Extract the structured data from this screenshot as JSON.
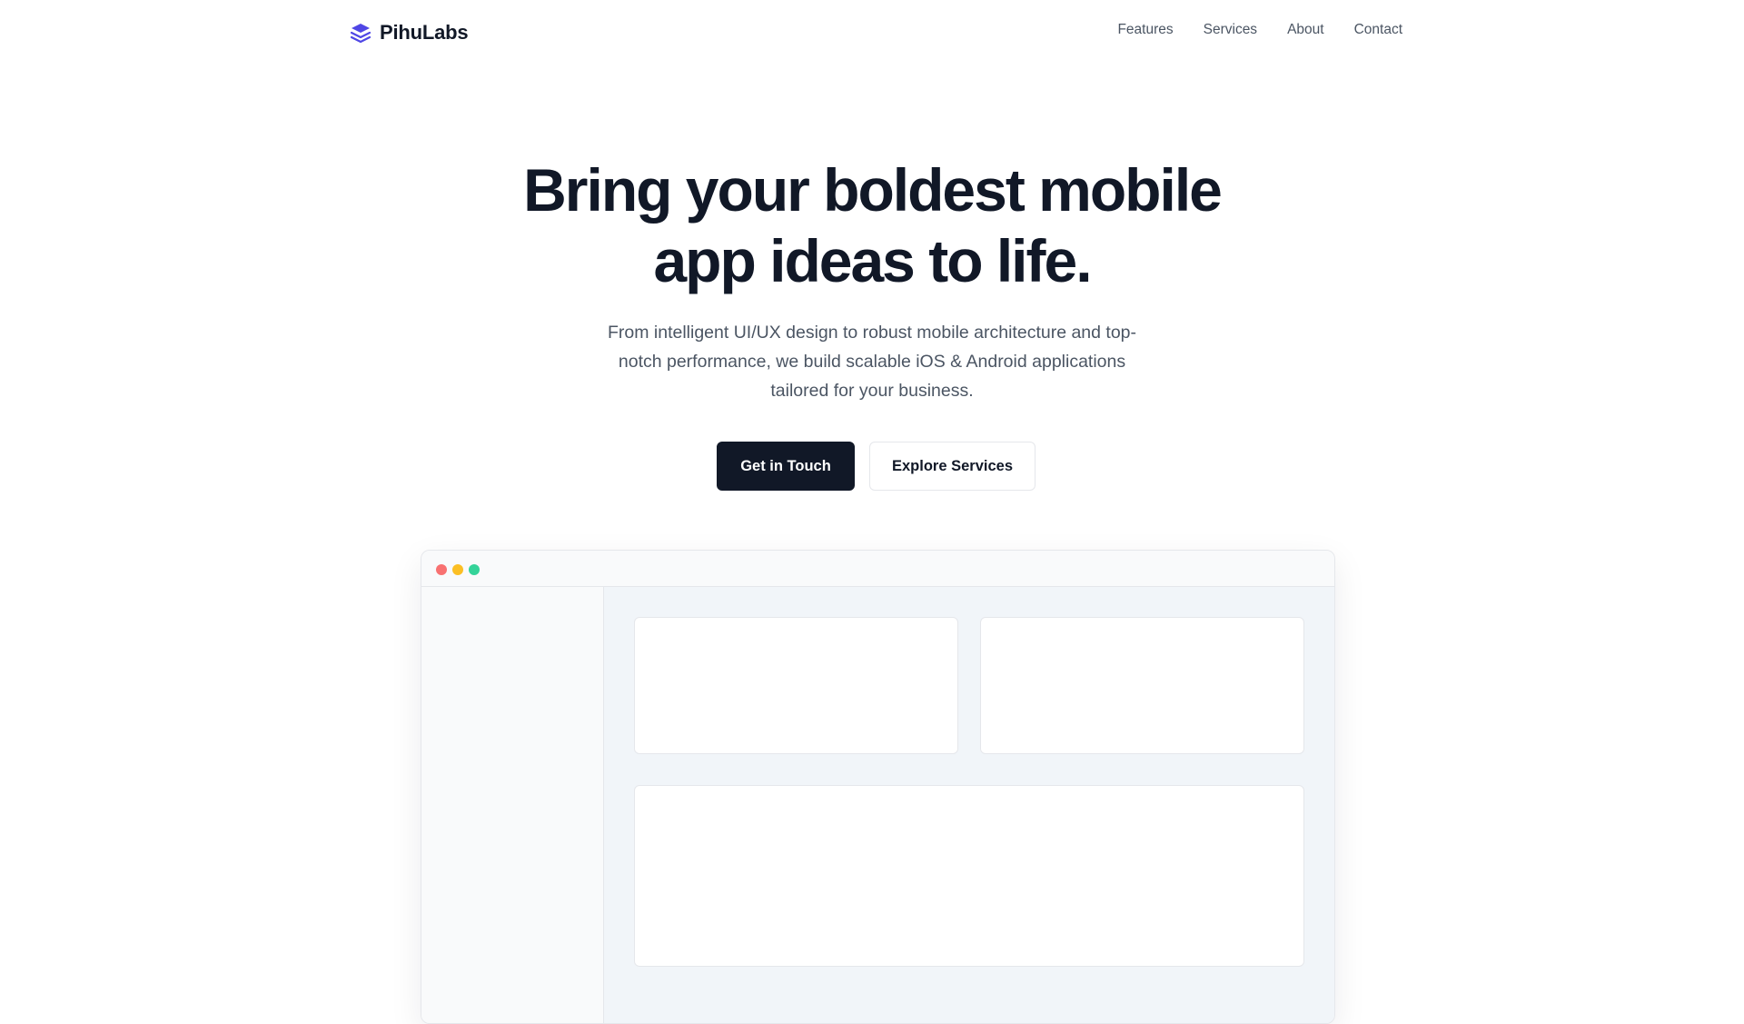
{
  "brand": {
    "name": "PihuLabs",
    "icon": "layers-icon",
    "color": "#4f46e5"
  },
  "nav": {
    "items": [
      {
        "label": "Features"
      },
      {
        "label": "Services"
      },
      {
        "label": "About"
      },
      {
        "label": "Contact"
      }
    ]
  },
  "hero": {
    "title_line1": "Bring your boldest mobile",
    "title_line2": "app ideas to life.",
    "subtitle": "From intelligent UI/UX design to robust mobile architecture and top-notch performance, we build scalable iOS & Android applications tailored for your business.",
    "primary_cta": "Get in Touch",
    "secondary_cta": "Explore Services"
  },
  "colors": {
    "text_dark": "#111827",
    "text_muted": "#4b5563",
    "accent": "#4f46e5",
    "window_dot_red": "#f87171",
    "window_dot_yellow": "#fbbf24",
    "window_dot_green": "#34d399"
  }
}
